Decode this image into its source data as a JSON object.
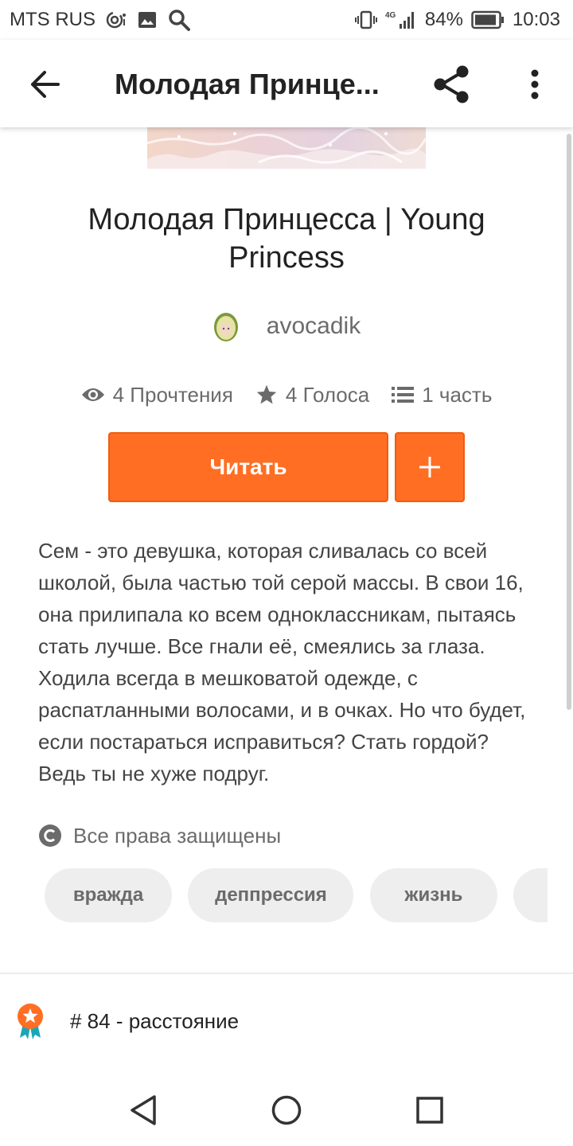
{
  "status_bar": {
    "carrier": "MTS RUS",
    "network": "4G",
    "battery": "84%",
    "time": "10:03"
  },
  "app_bar": {
    "title": "Молодая Принце..."
  },
  "story": {
    "title": "Молодая Принцесса | Young Princess",
    "author": "avocadik",
    "reads": "4 Прочтения",
    "votes": "4 Голоса",
    "parts": "1 часть",
    "description": "Сем - это девушка, которая сливалась со всей школой, была частью той серой массы. В свои 16, она прилипала ко всем одноклассникам, пытаясь стать лучше. Все гнали её, смеялись за глаза. Ходила всегда в мешковатой одежде, с распатланными волосами, и в очках. Но что будет, если постараться исправиться? Стать гордой? Ведь ты не хуже подруг.",
    "copyright": "Все права защищены",
    "tags": [
      "вражда",
      "деппрессия",
      "жизнь",
      "..."
    ],
    "rank": "# 84 - расстояние"
  },
  "buttons": {
    "read": "Читать",
    "add": "+"
  },
  "colors": {
    "accent": "#ff6e22",
    "muted_text": "#6b6b6b",
    "tag_bg": "#eeeeee",
    "badge": "#ff6e22",
    "badge_ribbon": "#1aa6b7"
  }
}
